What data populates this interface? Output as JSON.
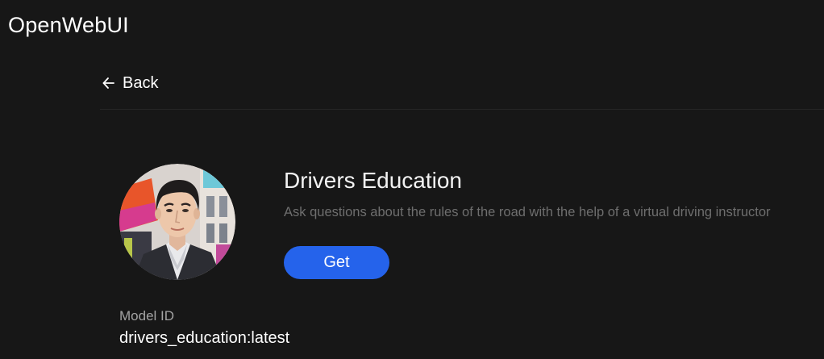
{
  "app": {
    "title": "OpenWebUI"
  },
  "nav": {
    "back_label": "Back",
    "back_icon": "arrow-left-icon"
  },
  "model": {
    "name": "Drivers Education",
    "description": "Ask questions about the rules of the road with the help of a virtual driving instructor",
    "get_label": "Get",
    "id_label": "Model ID",
    "id_value": "drivers_education:latest"
  },
  "colors": {
    "background": "#171717",
    "accent": "#2563eb",
    "muted_text": "#6e6e6e"
  }
}
